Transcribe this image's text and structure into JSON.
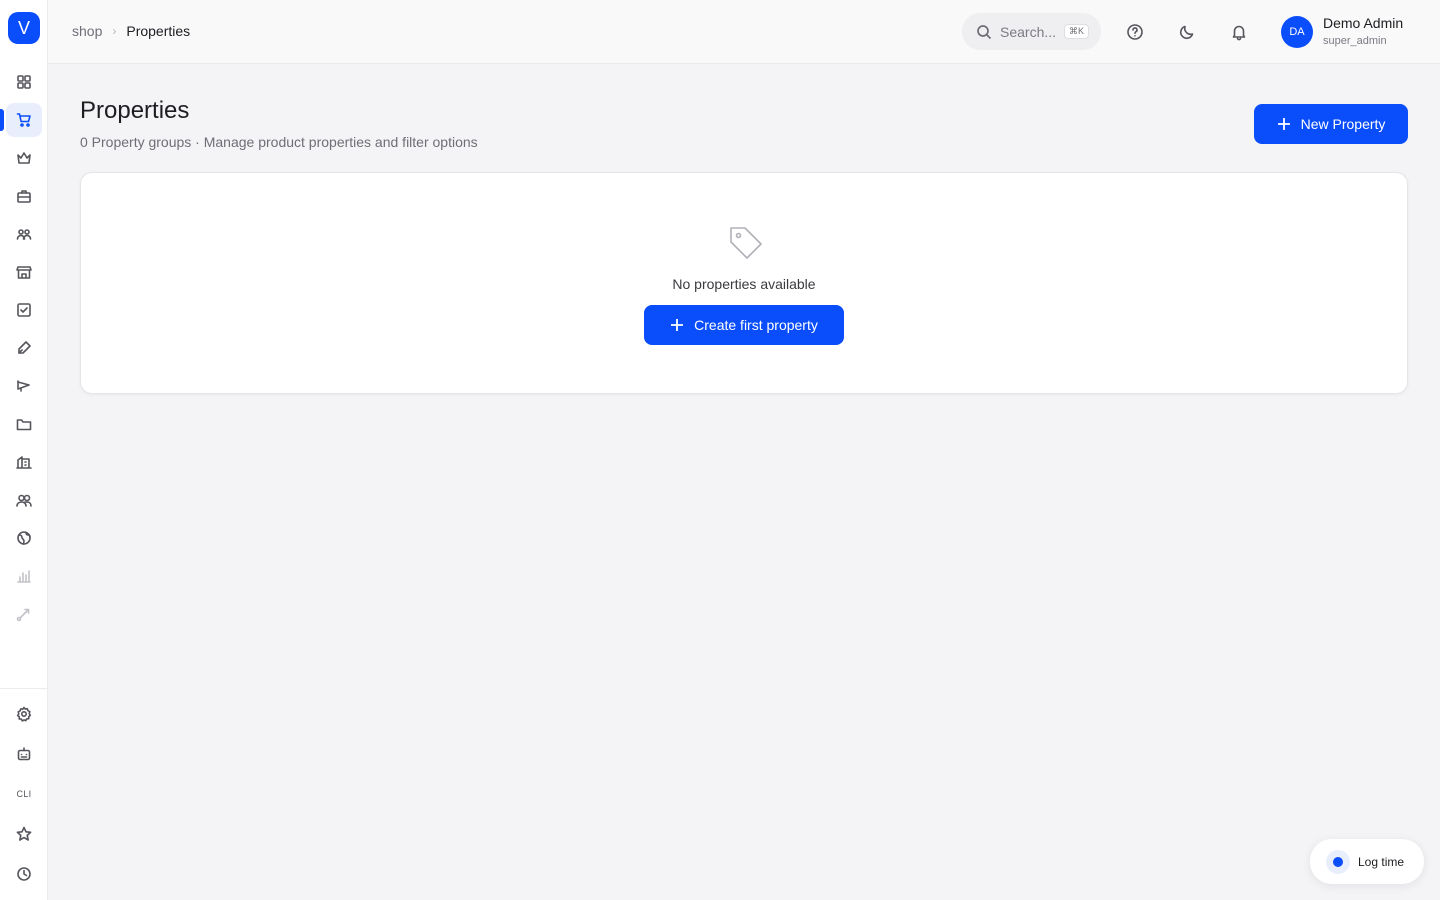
{
  "sidebar": {
    "logo_letter": "V",
    "cli_label": "CLI",
    "items": [
      {
        "icon": "dashboard-icon"
      },
      {
        "icon": "cart-icon",
        "active": true
      },
      {
        "icon": "crown-icon"
      },
      {
        "icon": "briefcase-icon"
      },
      {
        "icon": "users-icon"
      },
      {
        "icon": "store-icon"
      },
      {
        "icon": "checkbox-icon"
      },
      {
        "icon": "pen-icon"
      },
      {
        "icon": "megaphone-icon"
      },
      {
        "icon": "folder-icon"
      },
      {
        "icon": "building-icon"
      },
      {
        "icon": "team-icon"
      },
      {
        "icon": "globe-icon"
      },
      {
        "icon": "bar-chart-icon",
        "muted": true
      },
      {
        "icon": "route-icon",
        "muted": true
      }
    ],
    "bottom_items": [
      {
        "icon": "gear-icon"
      },
      {
        "icon": "robot-icon"
      },
      {
        "icon": "cli-icon"
      },
      {
        "icon": "star-icon"
      },
      {
        "icon": "clock-icon"
      }
    ]
  },
  "topbar": {
    "breadcrumb": [
      "shop",
      "Properties"
    ],
    "search_placeholder": "Search...",
    "search_shortcut": "⌘K",
    "icons": [
      "help-icon",
      "moon-icon",
      "bell-icon"
    ],
    "user": {
      "initials": "DA",
      "name": "Demo Admin",
      "role": "super_admin"
    }
  },
  "main": {
    "title": "Properties",
    "subtitle": "0 Property groups · Manage product properties and filter options",
    "new_button_label": "New Property",
    "empty_state": {
      "icon": "tag-icon",
      "message": "No properties available",
      "button_label": "Create first property"
    }
  },
  "floating": {
    "log_time_label": "Log time"
  },
  "colors": {
    "accent": "#0a4dfa",
    "background": "#f4f4f6"
  }
}
